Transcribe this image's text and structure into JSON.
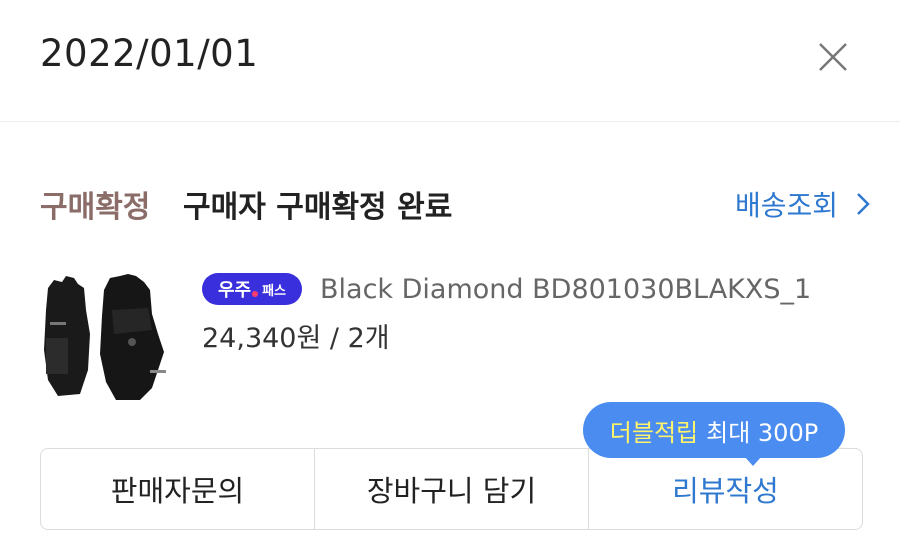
{
  "header": {
    "date": "2022/01/01",
    "close_icon": "close-icon"
  },
  "status": {
    "label": "구매확정",
    "text": "구매자 구매확정 완료",
    "tracking_label": "배송조회",
    "tracking_icon": "chevron-right-icon",
    "label_color": "#8a6d68",
    "link_color": "#2f78cf"
  },
  "product": {
    "image": "glove-image",
    "badge": {
      "part1": "우주",
      "part2": "패스",
      "color": "#3a2fdc"
    },
    "name": "Black Diamond BD801030BLAKXS_1",
    "price": "24,340원 / 2개"
  },
  "actions": {
    "seller_inquiry": "판매자문의",
    "add_cart": "장바구니 담기",
    "write_review": "리뷰작성"
  },
  "tooltip": {
    "highlight": "더블적립",
    "text": "최대 300P",
    "color": "#4a8cf0",
    "highlight_color": "#fff46a"
  }
}
